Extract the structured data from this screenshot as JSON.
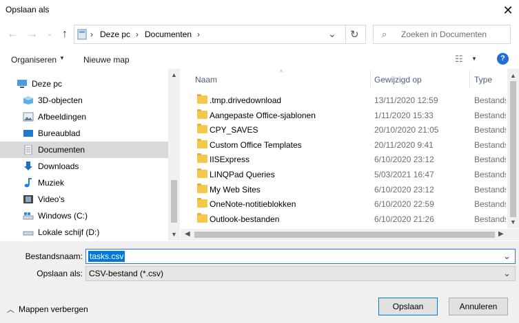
{
  "window": {
    "title": "Opslaan als"
  },
  "address": {
    "segments": [
      "Deze pc",
      "Documenten"
    ],
    "search_placeholder": "Zoeken in Documenten"
  },
  "toolbar": {
    "organize": "Organiseren",
    "new_folder": "Nieuwe map"
  },
  "nav": {
    "items": [
      {
        "label": "Deze pc",
        "icon": "pc-icon"
      },
      {
        "label": "3D-objecten",
        "icon": "cube-icon"
      },
      {
        "label": "Afbeeldingen",
        "icon": "pictures-icon"
      },
      {
        "label": "Bureaublad",
        "icon": "desktop-icon"
      },
      {
        "label": "Documenten",
        "icon": "documents-icon",
        "selected": true
      },
      {
        "label": "Downloads",
        "icon": "download-icon"
      },
      {
        "label": "Muziek",
        "icon": "music-icon"
      },
      {
        "label": "Video's",
        "icon": "video-icon"
      },
      {
        "label": "Windows (C:)",
        "icon": "drive-icon"
      },
      {
        "label": "Lokale schijf (D:)",
        "icon": "drive-icon"
      }
    ]
  },
  "files": {
    "columns": {
      "name": "Naam",
      "modified": "Gewijzigd op",
      "type": "Type"
    },
    "rows": [
      {
        "name": ".tmp.drivedownload",
        "modified": "13/11/2020 12:59",
        "type": "Bestandsmap"
      },
      {
        "name": "Aangepaste Office-sjablonen",
        "modified": "1/11/2020 15:33",
        "type": "Bestandsmap"
      },
      {
        "name": "CPY_SAVES",
        "modified": "20/10/2020 21:05",
        "type": "Bestandsmap"
      },
      {
        "name": "Custom Office Templates",
        "modified": "20/11/2020 9:41",
        "type": "Bestandsmap"
      },
      {
        "name": "IISExpress",
        "modified": "6/10/2020 23:12",
        "type": "Bestandsmap"
      },
      {
        "name": "LINQPad Queries",
        "modified": "5/03/2021 16:47",
        "type": "Bestandsmap"
      },
      {
        "name": "My Web Sites",
        "modified": "6/10/2020 23:12",
        "type": "Bestandsmap"
      },
      {
        "name": "OneNote-notitieblokken",
        "modified": "6/10/2020 22:59",
        "type": "Bestandsmap"
      },
      {
        "name": "Outlook-bestanden",
        "modified": "6/10/2020 21:26",
        "type": "Bestandsmap"
      }
    ]
  },
  "form": {
    "filename_label": "Bestandsnaam:",
    "filename_value": "tasks.csv",
    "filetype_label": "Opslaan als:",
    "filetype_value": "CSV-bestand (*.csv)"
  },
  "footer": {
    "hide_folders": "Mappen verbergen",
    "save": "Opslaan",
    "cancel": "Annuleren"
  },
  "colors": {
    "accent": "#0078d7",
    "selection_bg": "#d9d9d9",
    "folder": "#f5c84c"
  }
}
